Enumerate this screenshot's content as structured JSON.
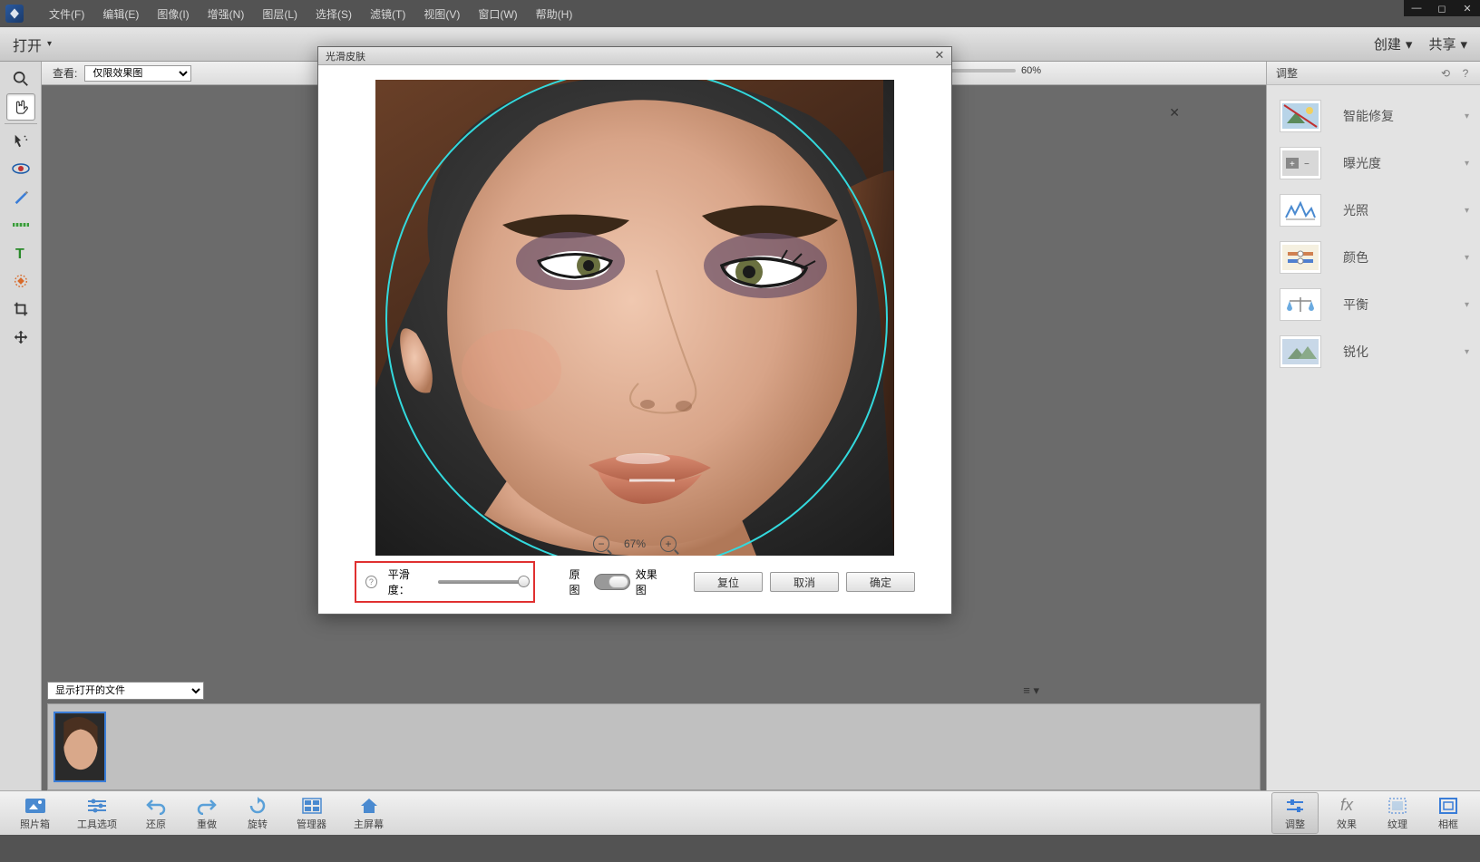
{
  "menu": {
    "file": "文件(F)",
    "edit": "编辑(E)",
    "image": "图像(I)",
    "enhance": "增强(N)",
    "layer": "图层(L)",
    "select": "选择(S)",
    "filter": "滤镜(T)",
    "view": "视图(V)",
    "window": "窗口(W)",
    "help": "帮助(H)"
  },
  "subbar": {
    "open": "打开",
    "create": "创建",
    "share": "共享"
  },
  "canvas": {
    "view_label": "查看:",
    "view_option": "仅限效果图",
    "zoom_pct": "60%"
  },
  "file_dropdown": "显示打开的文件",
  "right_panel": {
    "title": "调整",
    "items": [
      {
        "label": "智能修复"
      },
      {
        "label": "曝光度"
      },
      {
        "label": "光照"
      },
      {
        "label": "颜色"
      },
      {
        "label": "平衡"
      },
      {
        "label": "锐化"
      }
    ]
  },
  "dialog": {
    "title": "光滑皮肤",
    "preview_zoom": "67%",
    "smooth_label": "平滑度：",
    "before_label": "原图",
    "after_label": "效果图",
    "reset": "复位",
    "cancel": "取消",
    "ok": "确定"
  },
  "bottom": {
    "photo_bin": "照片箱",
    "tool_options": "工具选项",
    "undo": "还原",
    "redo": "重做",
    "rotate": "旋转",
    "organizer": "管理器",
    "home": "主屏幕",
    "adjust": "调整",
    "effects": "效果",
    "texture": "纹理",
    "frame": "相框"
  }
}
